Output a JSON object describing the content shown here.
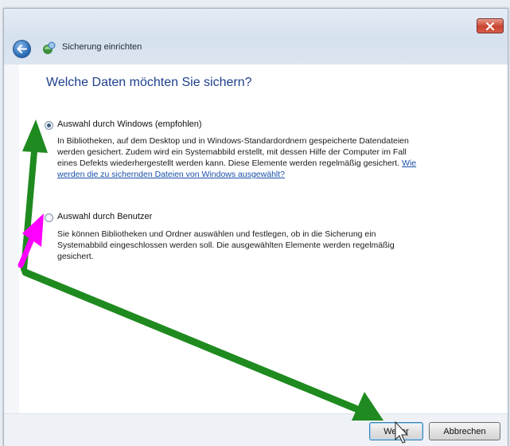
{
  "window": {
    "title": "Sicherung einrichten"
  },
  "content": {
    "heading": "Welche Daten möchten Sie sichern?",
    "options": [
      {
        "label": "Auswahl durch Windows (empfohlen)",
        "selected": true,
        "description_lines": [
          "In Bibliotheken, auf dem Desktop und in Windows-Standardordnern gespeicherte Datendateien",
          "werden gesichert. Zudem wird ein Systemabbild erstellt, mit dessen Hilfe der Computer im Fall",
          "eines Defekts wiederhergestellt werden kann. Diese Elemente werden regelmäßig gesichert."
        ],
        "link_part1": "Wie",
        "link_part2": "werden die zu sichernden Dateien von Windows ausgewählt?"
      },
      {
        "label": "Auswahl durch Benutzer",
        "selected": false,
        "description_lines": [
          "Sie können Bibliotheken und Ordner auswählen und festlegen, ob in die Sicherung ein",
          "Systemabbild eingeschlossen werden soll. Die ausgewählten Elemente werden regelmäßig",
          "gesichert."
        ]
      }
    ]
  },
  "footer": {
    "next_label": "Weiter",
    "cancel_label": "Abbrechen"
  },
  "colors": {
    "heading": "#1e3f8a",
    "link": "#1a4fa8",
    "annotation_green": "#1f8a1f",
    "annotation_magenta": "#ff00ff"
  },
  "icons": {
    "close": "close-icon",
    "back": "back-arrow-icon",
    "app": "backup-icon",
    "cursor": "mouse-cursor-icon"
  }
}
